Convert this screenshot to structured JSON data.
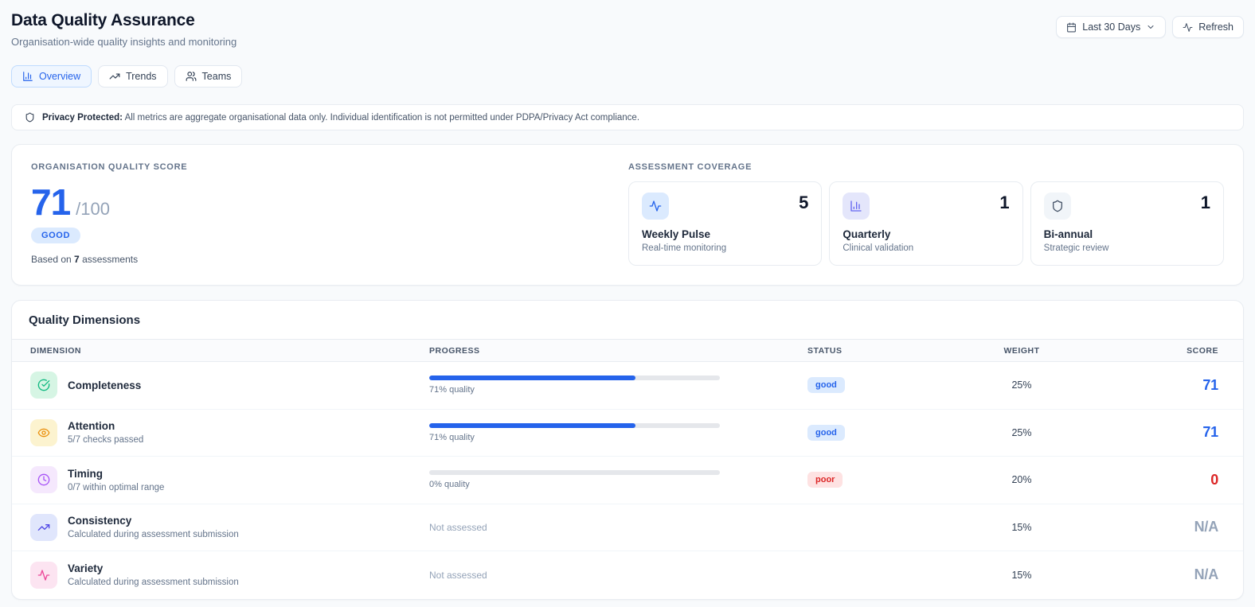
{
  "header": {
    "title": "Data Quality Assurance",
    "subtitle": "Organisation-wide quality insights and monitoring"
  },
  "controls": {
    "date_range": "Last 30 Days",
    "refresh": "Refresh"
  },
  "tabs": [
    {
      "label": "Overview",
      "icon": "bar-chart-icon",
      "active": true
    },
    {
      "label": "Trends",
      "icon": "trending-up-icon",
      "active": false
    },
    {
      "label": "Teams",
      "icon": "users-icon",
      "active": false
    }
  ],
  "privacy": {
    "label": "Privacy Protected:",
    "text": "All metrics are aggregate organisational data only. Individual identification is not permitted under PDPA/Privacy Act compliance."
  },
  "quality_score": {
    "section_label": "Organisation Quality Score",
    "score": "71",
    "max": "/100",
    "badge": "GOOD",
    "footnote_prefix": "Based on ",
    "assessment_count": "7",
    "footnote_suffix": " assessments"
  },
  "assessment_coverage": {
    "section_label": "Assessment Coverage",
    "cards": [
      {
        "title": "Weekly Pulse",
        "subtitle": "Real-time monitoring",
        "count": "5",
        "icon": "activity-icon",
        "icon_color": "#2563eb",
        "icon_bg": "#dbeafe"
      },
      {
        "title": "Quarterly",
        "subtitle": "Clinical validation",
        "count": "1",
        "icon": "bar-chart-icon",
        "icon_color": "#6366f1",
        "icon_bg": "#e4e6fb"
      },
      {
        "title": "Bi-annual",
        "subtitle": "Strategic review",
        "count": "1",
        "icon": "shield-icon",
        "icon_color": "#475569",
        "icon_bg": "#f1f5f9"
      }
    ]
  },
  "dimensions_table": {
    "title": "Quality Dimensions",
    "columns": [
      "DIMENSION",
      "PROGRESS",
      "STATUS",
      "WEIGHT",
      "SCORE"
    ],
    "status_styles": {
      "good": {
        "bg": "#dbeafe",
        "color": "#2563eb"
      },
      "poor": {
        "bg": "#fee2e2",
        "color": "#dc2626"
      }
    },
    "rows": [
      {
        "name": "Completeness",
        "subtitle": "",
        "icon": "check-circle-icon",
        "icon_color": "#10b981",
        "icon_bg": "#d6f5e4",
        "progress_type": "bar",
        "progress_pct": 71,
        "progress_label": "71% quality",
        "status": "good",
        "weight": "25%",
        "score": "71",
        "score_color": "#2563eb"
      },
      {
        "name": "Attention",
        "subtitle": "5/7 checks passed",
        "icon": "eye-icon",
        "icon_color": "#ea8f0b",
        "icon_bg": "#fcf3cf",
        "progress_type": "bar",
        "progress_pct": 71,
        "progress_label": "71% quality",
        "status": "good",
        "weight": "25%",
        "score": "71",
        "score_color": "#2563eb"
      },
      {
        "name": "Timing",
        "subtitle": "0/7 within optimal range",
        "icon": "clock-icon",
        "icon_color": "#a855f7",
        "icon_bg": "#f5e8fd",
        "progress_type": "bar",
        "progress_pct": 0,
        "progress_label": "0% quality",
        "status": "poor",
        "weight": "20%",
        "score": "0",
        "score_color": "#dc2626"
      },
      {
        "name": "Consistency",
        "subtitle": "Calculated during assessment submission",
        "icon": "trending-up-icon",
        "icon_color": "#4f46e5",
        "icon_bg": "#e0e6fc",
        "progress_type": "text",
        "progress_text": "Not assessed",
        "status": "",
        "weight": "15%",
        "score": "N/A",
        "score_color": "#94a3b8"
      },
      {
        "name": "Variety",
        "subtitle": "Calculated during assessment submission",
        "icon": "activity-icon",
        "icon_color": "#ec4899",
        "icon_bg": "#fce4f1",
        "progress_type": "text",
        "progress_text": "Not assessed",
        "status": "",
        "weight": "15%",
        "score": "N/A",
        "score_color": "#94a3b8"
      }
    ]
  }
}
